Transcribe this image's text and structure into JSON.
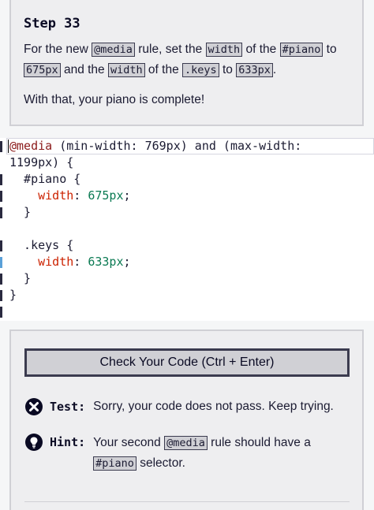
{
  "step": {
    "title": "Step 33",
    "desc": {
      "p1": "For the new ",
      "code1": "@media",
      "p2": " rule, set the ",
      "code2": "width",
      "p3": " of the ",
      "code3": "#piano",
      "p4": " to ",
      "code4": "675px",
      "p5": " and the ",
      "code5": "width",
      "p6": " of the ",
      "code6": ".keys",
      "p7": " to ",
      "code7": "633px",
      "p8": "."
    },
    "complete_text": "With that, your piano is complete!"
  },
  "editor": {
    "lines": [
      "@media (min-width: 769px) and (max-width:",
      "1199px) {",
      "  #piano {",
      "    width: 675px;",
      "  }",
      "",
      "  .keys {",
      "    width: 633px;",
      "  }",
      "}"
    ]
  },
  "actions": {
    "check_label": "Check Your Code (Ctrl + Enter)"
  },
  "test": {
    "label": "Test:",
    "text": "Sorry, your code does not pass. Keep trying."
  },
  "hint": {
    "label": "Hint:",
    "p1": "Your second ",
    "code1": "@media",
    "p2": " rule should have a ",
    "code2": "#piano",
    "p3": " selector."
  },
  "colors": {
    "panel_bg": "#eeeef0",
    "code_bg": "#d0d0d5",
    "at_rule": "#8b1a1a",
    "property": "#cc2200",
    "number": "#0b7a53"
  }
}
